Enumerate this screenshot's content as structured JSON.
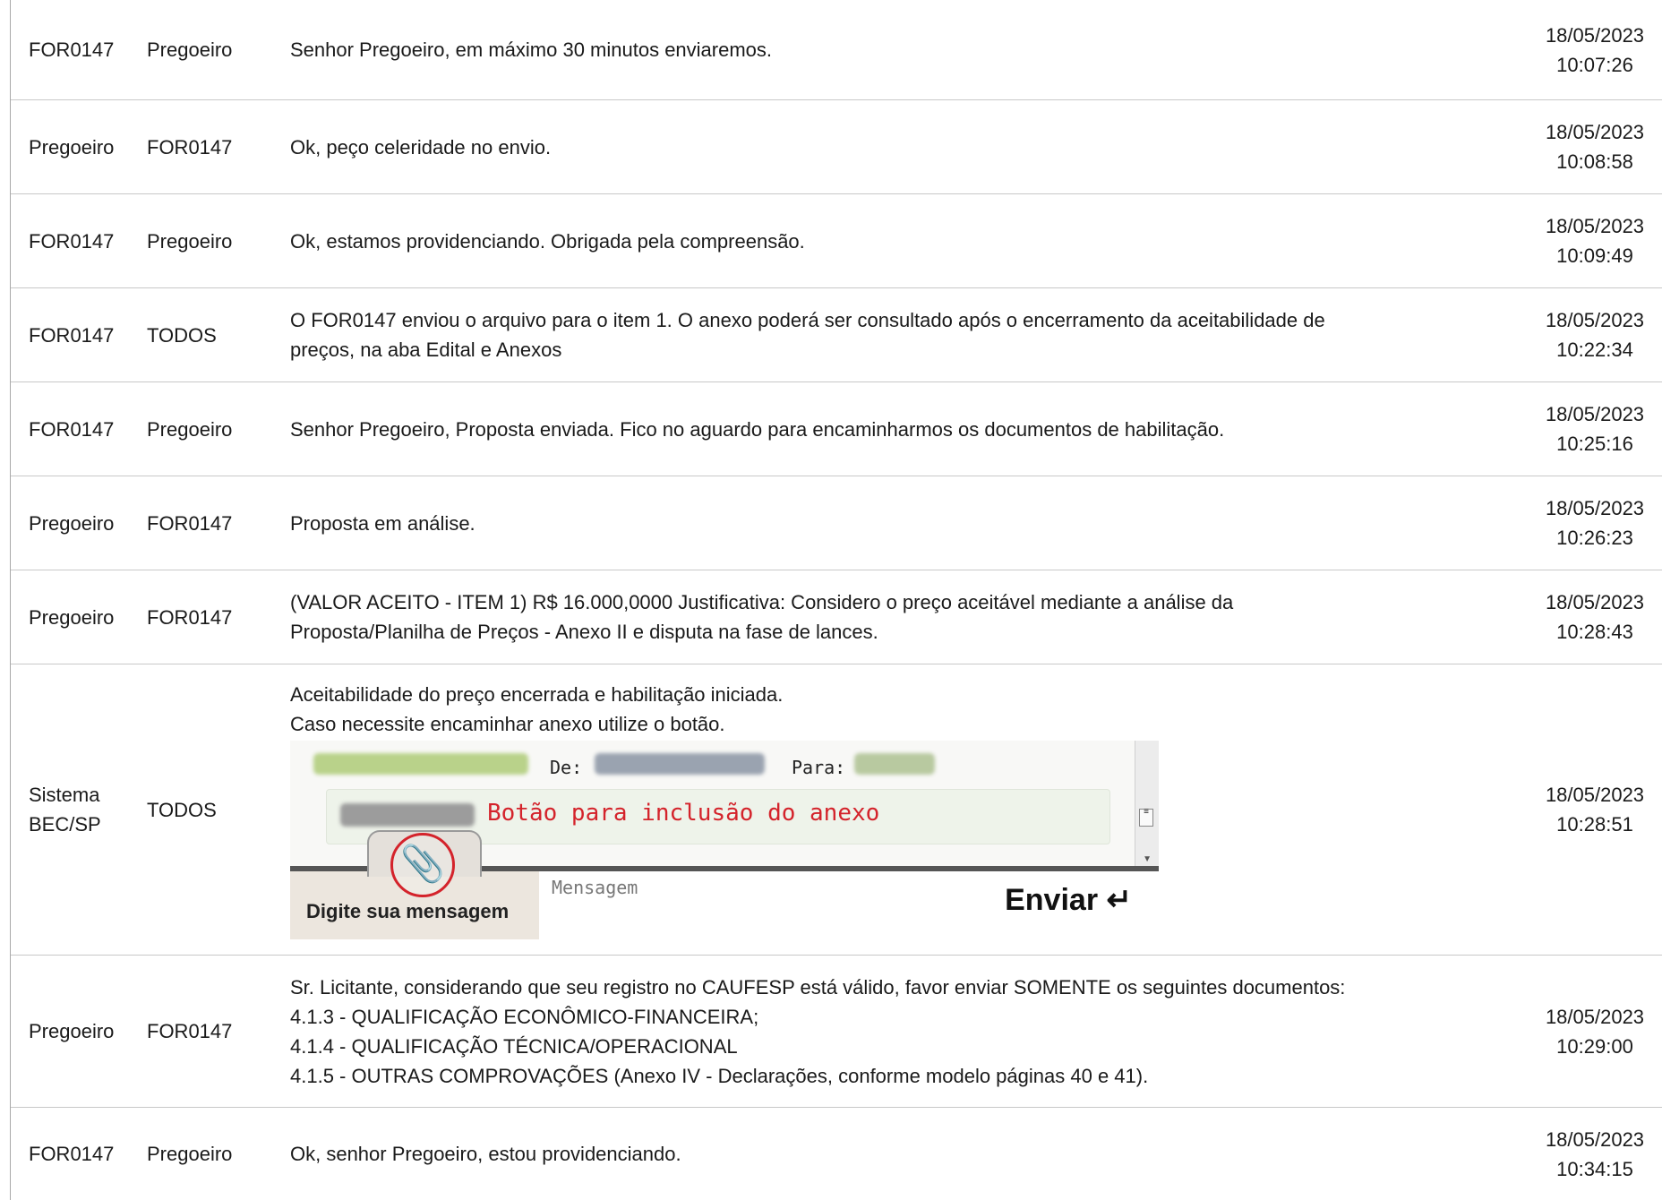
{
  "messages": [
    {
      "from": "FOR0147",
      "to": "Pregoeiro",
      "text": "Senhor Pregoeiro, em máximo 30 minutos enviaremos.",
      "date": "18/05/2023",
      "time": "10:07:26"
    },
    {
      "from": "Pregoeiro",
      "to": "FOR0147",
      "text": "Ok, peço celeridade no envio.",
      "date": "18/05/2023",
      "time": "10:08:58"
    },
    {
      "from": "FOR0147",
      "to": "Pregoeiro",
      "text": "Ok, estamos providenciando. Obrigada pela compreensão.",
      "date": "18/05/2023",
      "time": "10:09:49"
    },
    {
      "from": "FOR0147",
      "to": "TODOS",
      "text_lines": [
        "O FOR0147 enviou o arquivo para o item 1. O anexo poderá ser consultado após o encerramento da aceitabilidade de",
        "preços, na aba Edital e Anexos"
      ],
      "date": "18/05/2023",
      "time": "10:22:34"
    },
    {
      "from": "FOR0147",
      "to": "Pregoeiro",
      "text": "Senhor Pregoeiro, Proposta enviada. Fico no aguardo para encaminharmos os documentos de habilitação.",
      "date": "18/05/2023",
      "time": "10:25:16"
    },
    {
      "from": "Pregoeiro",
      "to": "FOR0147",
      "text": "Proposta em análise.",
      "date": "18/05/2023",
      "time": "10:26:23"
    },
    {
      "from": "Pregoeiro",
      "to": "FOR0147",
      "text_lines": [
        "(VALOR ACEITO - ITEM 1) R$ 16.000,0000 Justificativa: Considero o preço aceitável mediante a análise da",
        "Proposta/Planilha de Preços - Anexo II e disputa na fase de lances."
      ],
      "date": "18/05/2023",
      "time": "10:28:43"
    },
    {
      "from_lines": [
        "Sistema",
        "BEC/SP"
      ],
      "to": "TODOS",
      "text_lines": [
        "Aceitabilidade do preço encerrada e habilitação iniciada.",
        "Caso necessite encaminhar anexo utilize o botão."
      ],
      "date": "18/05/2023",
      "time": "10:28:51",
      "screenshot": {
        "de_label": "De:",
        "para_label": "Para:",
        "callout": "Botão para inclusão do anexo",
        "tab_label": "Digite sua mensagem",
        "placeholder": "Mensagem",
        "send_label": "Enviar ↵",
        "icon": "paperclip-icon",
        "accent_color": "#d4232b"
      }
    },
    {
      "from": "Pregoeiro",
      "to": "FOR0147",
      "text_lines": [
        "Sr. Licitante, considerando que seu registro no CAUFESP está válido, favor enviar SOMENTE os seguintes documentos:",
        "4.1.3 - QUALIFICAÇÃO ECONÔMICO-FINANCEIRA;",
        "4.1.4 - QUALIFICAÇÃO TÉCNICA/OPERACIONAL",
        "4.1.5 - OUTRAS COMPROVAÇÕES (Anexo IV - Declarações, conforme modelo páginas 40 e 41)."
      ],
      "date": "18/05/2023",
      "time": "10:29:00"
    },
    {
      "from": "FOR0147",
      "to": "Pregoeiro",
      "text": "Ok, senhor Pregoeiro, estou providenciando.",
      "date": "18/05/2023",
      "time": "10:34:15"
    }
  ]
}
